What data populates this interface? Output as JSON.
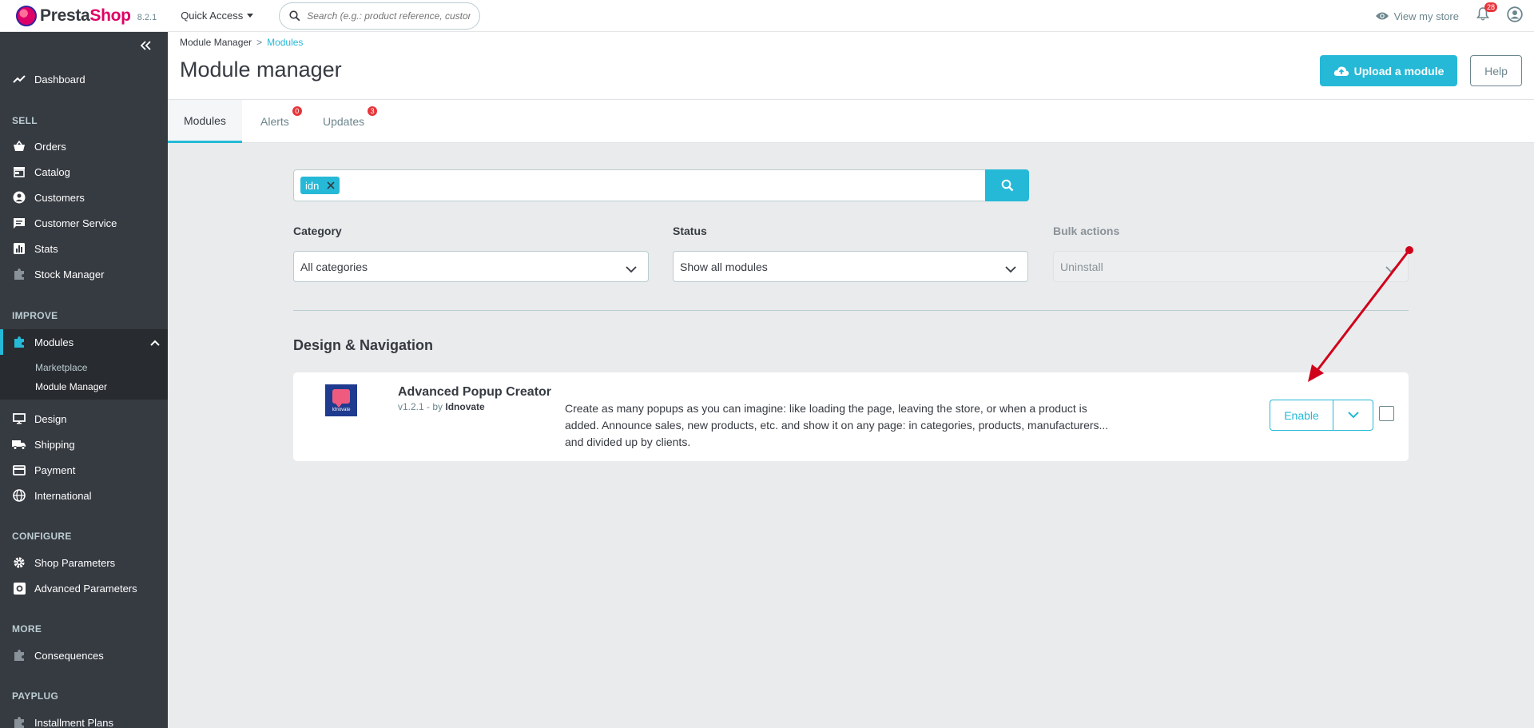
{
  "header": {
    "brand_first": "Presta",
    "brand_second": "Shop",
    "version": "8.2.1",
    "quick_access": "Quick Access",
    "search_placeholder": "Search (e.g.: product reference, custon",
    "view_store": "View my store",
    "notifications_count": "28",
    "icons": [
      "search-icon",
      "eye-icon",
      "bell-icon",
      "user-icon"
    ]
  },
  "sidebar": {
    "items": [
      {
        "label": "Dashboard",
        "icon": "trending-up-icon"
      },
      {
        "label": "Orders",
        "icon": "basket-icon"
      },
      {
        "label": "Catalog",
        "icon": "store-icon"
      },
      {
        "label": "Customers",
        "icon": "account-icon"
      },
      {
        "label": "Customer Service",
        "icon": "chat-icon"
      },
      {
        "label": "Stats",
        "icon": "bar-chart-icon"
      },
      {
        "label": "Stock Manager",
        "icon": "puzzle-icon"
      },
      {
        "label": "Modules",
        "icon": "puzzle-icon"
      },
      {
        "label": "Design",
        "icon": "desktop-icon"
      },
      {
        "label": "Shipping",
        "icon": "truck-icon"
      },
      {
        "label": "Payment",
        "icon": "credit-card-icon"
      },
      {
        "label": "International",
        "icon": "globe-icon"
      },
      {
        "label": "Shop Parameters",
        "icon": "gear-icon"
      },
      {
        "label": "Advanced Parameters",
        "icon": "settings-box-icon"
      },
      {
        "label": "Consequences",
        "icon": "puzzle-icon"
      },
      {
        "label": "Installment Plans",
        "icon": "puzzle-icon"
      }
    ],
    "sections": [
      "SELL",
      "IMPROVE",
      "CONFIGURE",
      "MORE",
      "PAYPLUG"
    ],
    "submenu": [
      "Marketplace",
      "Module Manager"
    ]
  },
  "page": {
    "breadcrumb_parent": "Module Manager",
    "breadcrumb_separator": ">",
    "breadcrumb_current": "Modules",
    "title": "Module manager",
    "upload_button": "Upload a module",
    "help_button": "Help",
    "tabs": [
      {
        "label": "Modules",
        "badge": ""
      },
      {
        "label": "Alerts",
        "badge": "0"
      },
      {
        "label": "Updates",
        "badge": "3"
      }
    ]
  },
  "filters": {
    "tag": "idn",
    "category_label": "Category",
    "category_value": "All categories",
    "status_label": "Status",
    "status_value": "Show all modules",
    "bulk_label": "Bulk actions",
    "bulk_value": "Uninstall"
  },
  "module_category": "Design & Navigation",
  "module": {
    "logo_text": "Idnovate",
    "name": "Advanced Popup Creator",
    "version_prefix": "v1.2.1 - by ",
    "author": "Idnovate",
    "description": "Create as many popups as you can imagine: like loading the page, leaving the store, or when a product is added. Announce sales, new products, etc. and show it on any page: in categories, products, manufacturers... and divided up by clients.",
    "enable_button": "Enable"
  },
  "colors": {
    "accent": "#25b9d7",
    "sidebar": "#363a41",
    "badge": "#e6363b",
    "annotation_arrow": "#d0021b"
  }
}
